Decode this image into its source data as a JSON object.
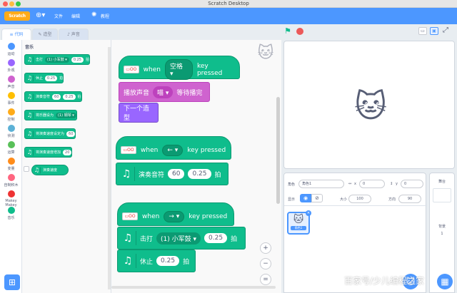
{
  "window": {
    "title": "Scratch Desktop"
  },
  "menubar": {
    "logo": "Scratch",
    "file": "文件",
    "edit": "编辑",
    "tutorials": "教程",
    "globe_icon": "globe-icon",
    "bulb_icon": "lightbulb-icon"
  },
  "tabs": {
    "code": "代码",
    "costumes": "造型",
    "sounds": "声音"
  },
  "categories": [
    {
      "label": "运动",
      "color": "#4c97ff"
    },
    {
      "label": "外观",
      "color": "#9966ff"
    },
    {
      "label": "声音",
      "color": "#cf63cf"
    },
    {
      "label": "事件",
      "color": "#ffbf00"
    },
    {
      "label": "控制",
      "color": "#ffab19"
    },
    {
      "label": "侦测",
      "color": "#5cb1d6"
    },
    {
      "label": "运算",
      "color": "#59c059"
    },
    {
      "label": "变量",
      "color": "#ff8c1a"
    },
    {
      "label": "自制积木",
      "color": "#ff6680"
    },
    {
      "label": "Makey Makey",
      "color": "#e33"
    },
    {
      "label": "音乐",
      "color": "#0fbd8c"
    }
  ],
  "palette": {
    "header": "音乐",
    "blocks": [
      {
        "pre": "击打",
        "dd": "(1) 小军鼓",
        "val": "0.25",
        "post": "拍"
      },
      {
        "pre": "休止",
        "dd": "",
        "val": "0.25",
        "post": "拍"
      },
      {
        "pre": "演奏音符",
        "dd": "",
        "val": "60",
        "val2": "0.25",
        "post": "拍"
      },
      {
        "pre": "将乐器设为",
        "dd": "(1) 钢琴",
        "val": "",
        "post": ""
      },
      {
        "pre": "将演奏速度设定为",
        "dd": "",
        "val": "60",
        "post": ""
      },
      {
        "pre": "将演奏速度增加",
        "dd": "",
        "val": "20",
        "post": ""
      }
    ],
    "reporter": "演奏速度"
  },
  "scripts": [
    {
      "when": "when",
      "key": "空格",
      "pressed": "key pressed",
      "play": "播放声音",
      "sound": "喵",
      "until": "等待播完",
      "next": "下一个造型"
    },
    {
      "when": "when",
      "key": "←",
      "pressed": "key pressed",
      "note": "演奏音符",
      "n1": "60",
      "n2": "0.25",
      "beat": "拍"
    },
    {
      "when": "when",
      "key": "→",
      "pressed": "key pressed",
      "drum": "击打",
      "drumname": "(1) 小军鼓",
      "d1": "0.25",
      "beat": "拍",
      "rest": "休止",
      "r1": "0.25",
      "beat2": "拍"
    }
  ],
  "zoom": {
    "in": "+",
    "out": "−",
    "reset": "="
  },
  "sprite_info": {
    "sprite_label": "角色",
    "sprite_name": "角色1",
    "x_label": "x",
    "x_val": "0",
    "y_label": "y",
    "y_val": "0",
    "show_label": "显示",
    "size_label": "大小",
    "size_val": "100",
    "dir_label": "方向",
    "dir_val": "90",
    "thumb_name": "角色1"
  },
  "stage_panel": {
    "title": "舞台",
    "bg_label": "背景",
    "bg_count": "1"
  },
  "watermark": "百家号/少儿编程之家",
  "colors": {
    "blue": "#4c97ff",
    "green": "#0fbd8c",
    "pink": "#cf63cf",
    "purple": "#9966ff"
  }
}
